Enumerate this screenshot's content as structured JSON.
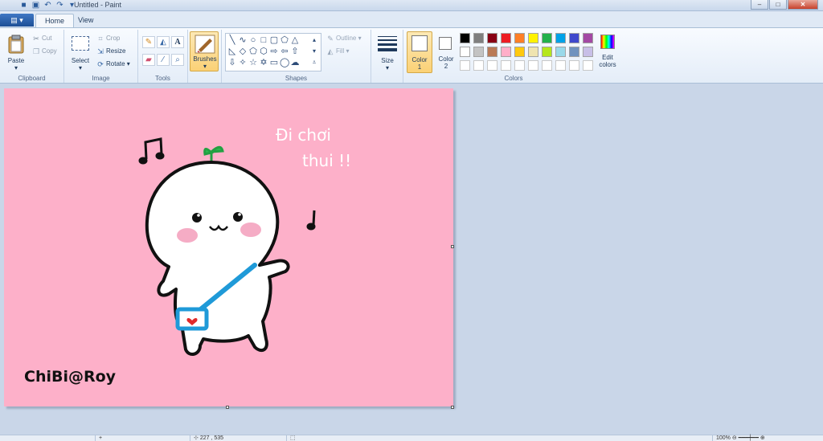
{
  "window": {
    "title": "Untitled - Paint",
    "minimize_glyph": "–",
    "maximize_glyph": "□",
    "close_glyph": "✕"
  },
  "app_menu": {
    "label": "▾"
  },
  "tabs": [
    {
      "label": "Home",
      "active": true
    },
    {
      "label": "View",
      "active": false
    }
  ],
  "ribbon": {
    "clipboard": {
      "label": "Clipboard",
      "paste": "Paste",
      "cut": "Cut",
      "copy": "Copy"
    },
    "image": {
      "label": "Image",
      "select": "Select",
      "crop": "Crop",
      "resize": "Resize",
      "rotate": "Rotate"
    },
    "tools": {
      "label": "Tools"
    },
    "brushes": {
      "label": "Brushes"
    },
    "shapes": {
      "label": "Shapes",
      "outline": "Outline",
      "fill": "Fill"
    },
    "size": {
      "label": "Size"
    },
    "colors": {
      "label": "Colors",
      "color1_label": "Color",
      "color1_num": "1",
      "color2_label": "Color",
      "color2_num": "2",
      "edit": "Edit colors",
      "palette_row1": [
        "#000000",
        "#7f7f7f",
        "#880015",
        "#ed1c24",
        "#ff7f27",
        "#fff200",
        "#22b14c",
        "#00a2e8",
        "#3f48cc",
        "#a349a4"
      ],
      "palette_row2": [
        "#ffffff",
        "#c3c3c3",
        "#b97a57",
        "#ffaec9",
        "#ffc90e",
        "#efe4b0",
        "#b5e61d",
        "#99d9ea",
        "#7092be",
        "#c8bfe7"
      ],
      "color1": "#ffffff",
      "color2": "#ffffff"
    }
  },
  "canvas": {
    "background": "#fdb0c9",
    "text_line1": "Đi chơi",
    "text_line2": "thui !!",
    "signature": "ChiBi@Roy"
  },
  "statusbar": {
    "pos": "227 , 535",
    "zoom": "100%"
  }
}
